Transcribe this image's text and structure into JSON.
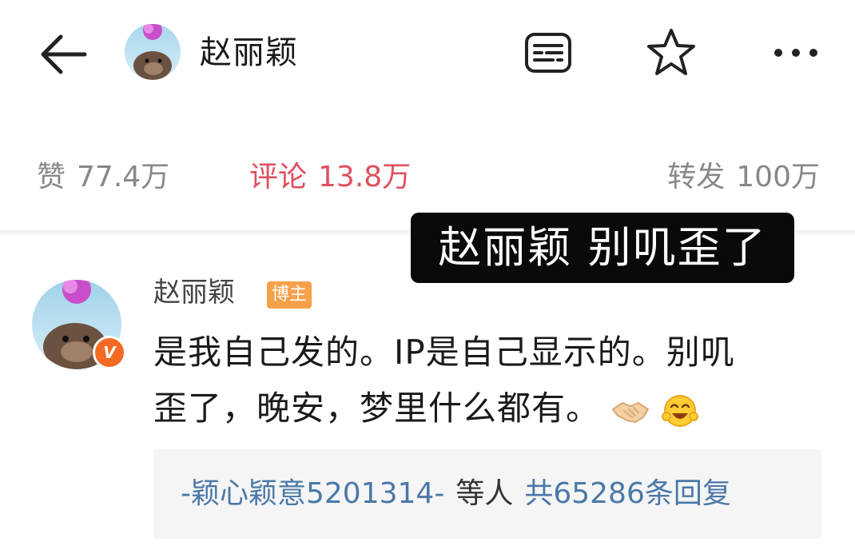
{
  "header": {
    "back_icon": "arrow-left-icon",
    "user_name": "赵丽颖",
    "reader_icon": "reader-mode-icon",
    "star_icon": "star-outline-icon",
    "more_icon": "more-dots-icon"
  },
  "stats": {
    "like_label": "赞",
    "like_count": "77.4万",
    "comment_label": "评论",
    "comment_count": "13.8万",
    "repost_label": "转发",
    "repost_count": "100万",
    "active_color": "#e04f5f"
  },
  "caption": "赵丽颖 别叽歪了",
  "comment": {
    "user_name": "赵丽颖",
    "badge": "博主",
    "verified_badge": "V",
    "text_line1": "是我自己发的。IP是自己显示的。别叽",
    "text_line2": "歪了，晚安，梦里什么都有。",
    "emojis": [
      "handshake-icon",
      "laughing-face-icon"
    ],
    "replies": {
      "user": "-颖心颖意5201314-",
      "middle": "等人",
      "count_text": "共65286条回复"
    }
  }
}
